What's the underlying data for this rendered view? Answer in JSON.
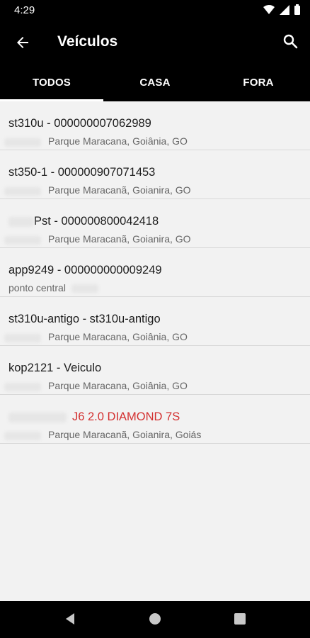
{
  "status": {
    "time": "4:29"
  },
  "appbar": {
    "title": "Veículos",
    "back_icon": "arrow-back-icon",
    "search_icon": "search-icon"
  },
  "tabs": [
    {
      "label": "TODOS",
      "active": true
    },
    {
      "label": "CASA",
      "active": false
    },
    {
      "label": "FORA",
      "active": false
    }
  ],
  "vehicles": [
    {
      "title": "st310u - 000000007062989",
      "address": "Parque Maracana, Goiânia, GO"
    },
    {
      "title": "st350-1 - 000000907071453",
      "address": "Parque Maracanã, Goianira, GO"
    },
    {
      "title": "Pst - 000000800042418",
      "address": "Parque Maracanã, Goianira, GO"
    },
    {
      "title": "app9249 - 000000000009249",
      "address": "ponto central"
    },
    {
      "title": "st310u-antigo - st310u-antigo",
      "address": "Parque Maracana, Goiânia, GO"
    },
    {
      "title": "kop2121 - Veiculo",
      "address": "Parque Maracana, Goiânia, GO"
    },
    {
      "title": "J6 2.0 DIAMOND 7S",
      "address": "Parque Maracanã, Goianira, Goiás"
    }
  ],
  "colors": {
    "bar": "#000000",
    "background": "#f2f2f2",
    "alert_text": "#d32f2f"
  }
}
